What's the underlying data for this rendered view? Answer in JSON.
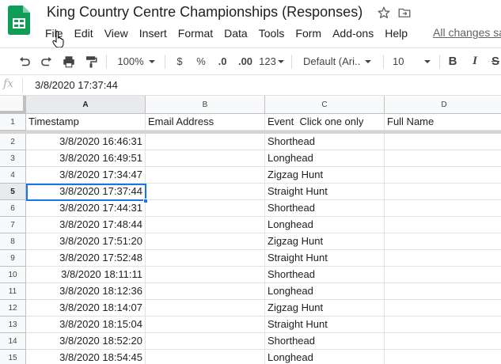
{
  "doc": {
    "title": "King Country Centre Championships (Responses)",
    "save_status": "All changes saved in Drive"
  },
  "menu": [
    "File",
    "Edit",
    "View",
    "Insert",
    "Format",
    "Data",
    "Tools",
    "Form",
    "Add-ons",
    "Help"
  ],
  "toolbar": {
    "zoom": "100%",
    "currency": "$",
    "percent": "%",
    "decrease_decimals": ".0",
    "increase_decimals": ".00",
    "more_formats": "123",
    "font": "Default (Ari...",
    "font_size": "10",
    "bold": "B",
    "italic": "I",
    "strikethrough": "S"
  },
  "formula_bar": {
    "icon": "fx",
    "value": "3/8/2020 17:37:44"
  },
  "grid": {
    "columns": [
      "A",
      "B",
      "C",
      "D"
    ],
    "header_row": {
      "number": "1",
      "cells": [
        "Timestamp",
        "Email Address",
        "Event  Click one only",
        "Full Name"
      ]
    },
    "rows": [
      {
        "number": "2",
        "cells": [
          "3/8/2020 16:46:31",
          "",
          "Shorthead",
          ""
        ]
      },
      {
        "number": "3",
        "cells": [
          "3/8/2020 16:49:51",
          "",
          "Longhead",
          ""
        ]
      },
      {
        "number": "4",
        "cells": [
          "3/8/2020 17:34:47",
          "",
          "Zigzag Hunt",
          ""
        ]
      },
      {
        "number": "5",
        "cells": [
          "3/8/2020 17:37:44",
          "",
          "Straight Hunt",
          ""
        ]
      },
      {
        "number": "6",
        "cells": [
          "3/8/2020 17:44:31",
          "",
          "Shorthead",
          ""
        ]
      },
      {
        "number": "7",
        "cells": [
          "3/8/2020 17:48:44",
          "",
          "Longhead",
          ""
        ]
      },
      {
        "number": "8",
        "cells": [
          "3/8/2020 17:51:20",
          "",
          "Zigzag Hunt",
          ""
        ]
      },
      {
        "number": "9",
        "cells": [
          "3/8/2020 17:52:48",
          "",
          "Straight Hunt",
          ""
        ]
      },
      {
        "number": "10",
        "cells": [
          "3/8/2020 18:11:11",
          "",
          "Shorthead",
          ""
        ]
      },
      {
        "number": "11",
        "cells": [
          "3/8/2020 18:12:36",
          "",
          "Longhead",
          ""
        ]
      },
      {
        "number": "12",
        "cells": [
          "3/8/2020 18:14:07",
          "",
          "Zigzag Hunt",
          ""
        ]
      },
      {
        "number": "13",
        "cells": [
          "3/8/2020 18:15:04",
          "",
          "Straight Hunt",
          ""
        ]
      },
      {
        "number": "14",
        "cells": [
          "3/8/2020 18:52:20",
          "",
          "Shorthead",
          ""
        ]
      },
      {
        "number": "15",
        "cells": [
          "3/8/2020 18:54:45",
          "",
          "Longhead",
          ""
        ]
      }
    ],
    "active_cell": {
      "column": "A",
      "row": "5"
    }
  },
  "colors": {
    "sheets_green": "#0f9d58",
    "selection_blue": "#1a73e8",
    "header_bg": "#f8f9fa"
  }
}
